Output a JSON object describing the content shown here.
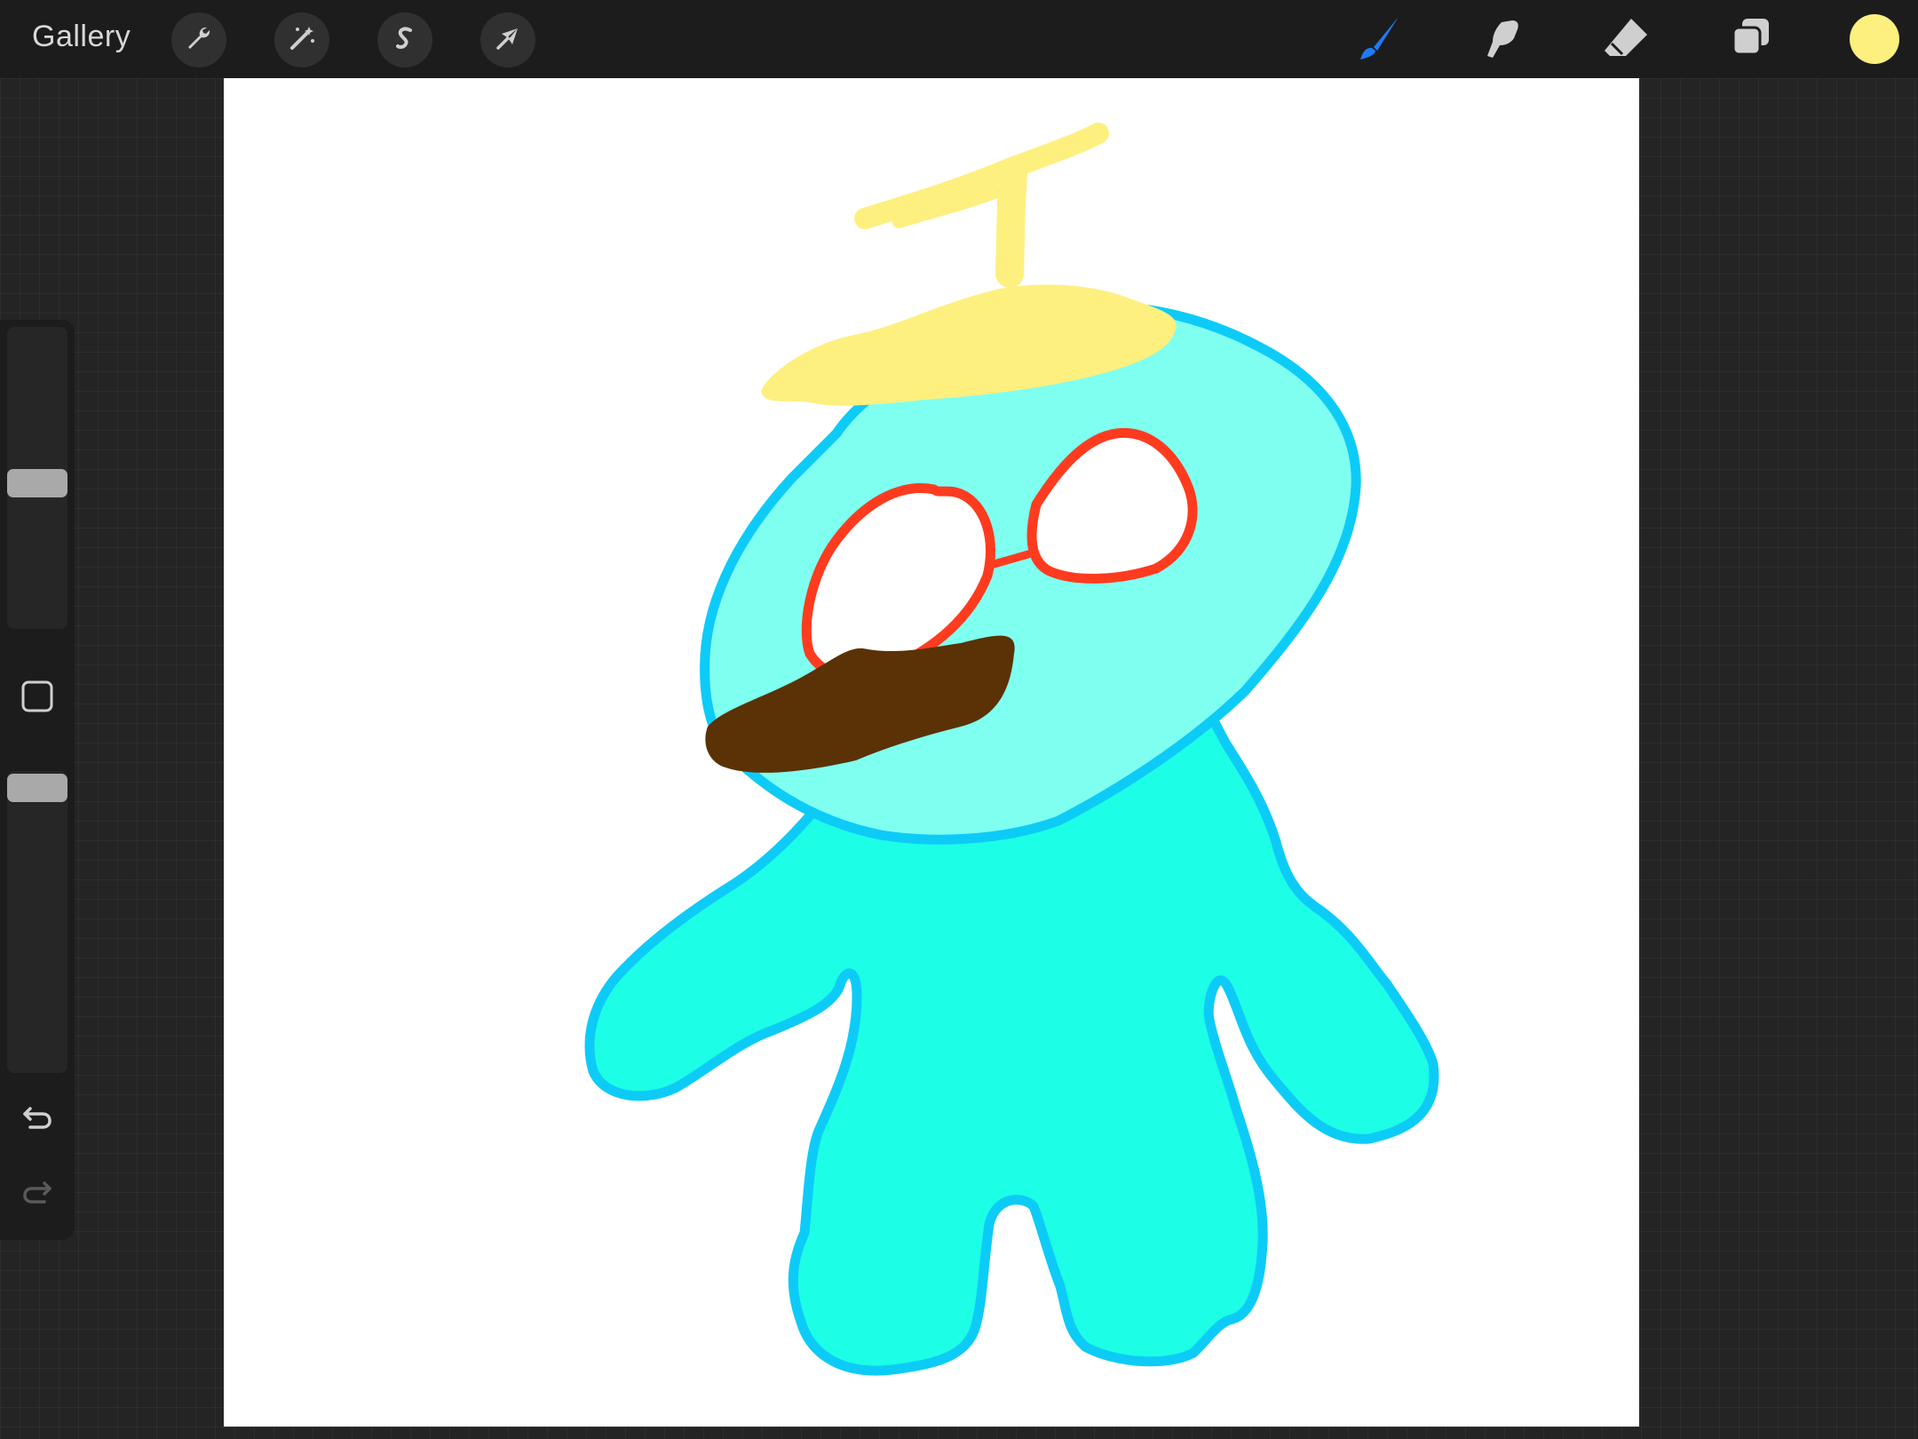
{
  "app": {
    "gallery_label": "Gallery"
  },
  "toolbar_left": [
    {
      "icon": "wrench-icon",
      "name": "actions"
    },
    {
      "icon": "magic-wand-icon",
      "name": "adjustments"
    },
    {
      "icon": "selection-icon",
      "name": "selection"
    },
    {
      "icon": "transform-arrow-icon",
      "name": "transform"
    }
  ],
  "toolbar_right": [
    {
      "icon": "brush-icon",
      "name": "paint",
      "active": true
    },
    {
      "icon": "smudge-icon",
      "name": "smudge",
      "active": false
    },
    {
      "icon": "eraser-icon",
      "name": "erase",
      "active": false
    },
    {
      "icon": "layers-icon",
      "name": "layers",
      "active": false
    }
  ],
  "current_color": "#FDF07F",
  "sidebar": {
    "brush_size_level": 0.48,
    "opacity_level": 0.99,
    "modify_icon": "square-icon",
    "undo_icon": "undo-icon",
    "redo_icon": "redo-icon"
  },
  "colors": {
    "active_tool": "#1E7BF5",
    "tool_icon": "#cfcfcf",
    "body_fill": "#1CFFE6",
    "head_fill": "#7FFFF0",
    "outline": "#0DCBF7",
    "hat": "#FDF07F",
    "glasses": "#FF3B1F",
    "mustache": "#5A3206"
  }
}
